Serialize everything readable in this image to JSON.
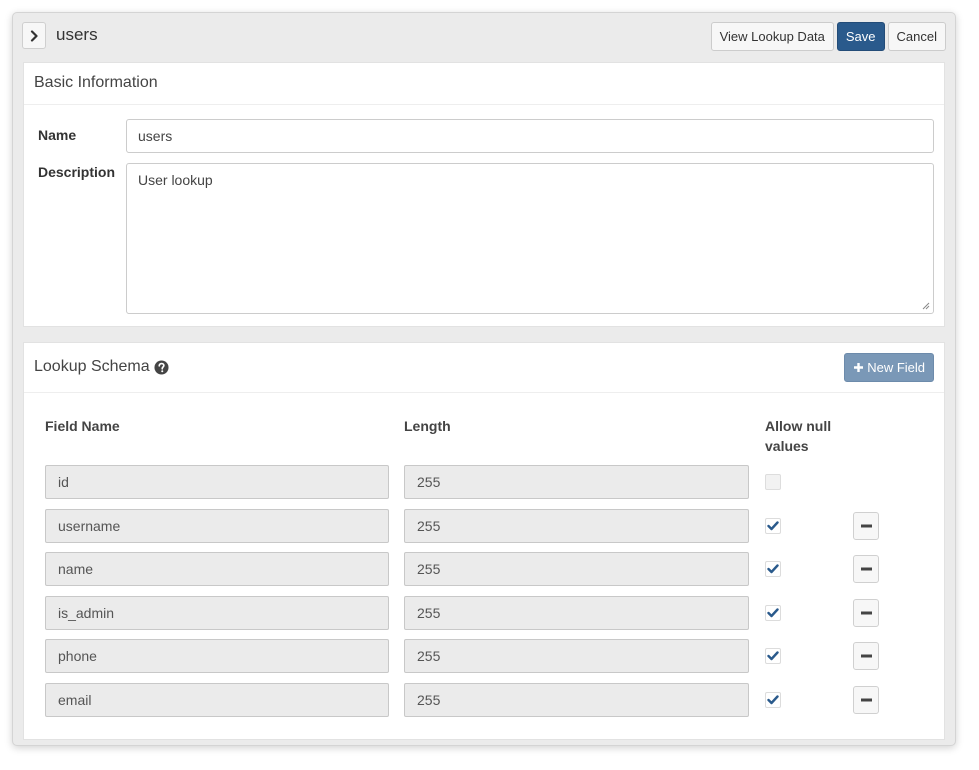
{
  "header": {
    "title": "users",
    "expand_icon": "chevron-right-icon",
    "view_lookup_label": "View Lookup Data",
    "save_label": "Save",
    "cancel_label": "Cancel"
  },
  "basic_info": {
    "heading": "Basic Information",
    "name_label": "Name",
    "name_value": "users",
    "description_label": "Description",
    "description_value": "User lookup"
  },
  "schema": {
    "heading": "Lookup Schema",
    "help_icon": "question-circle-icon",
    "new_field_label": "New Field",
    "columns": {
      "field_name": "Field Name",
      "length": "Length",
      "allow_null": "Allow null values"
    },
    "rows": [
      {
        "field_name": "id",
        "length": "255",
        "allow_null": false,
        "removable": false
      },
      {
        "field_name": "username",
        "length": "255",
        "allow_null": true,
        "removable": true
      },
      {
        "field_name": "name",
        "length": "255",
        "allow_null": true,
        "removable": true
      },
      {
        "field_name": "is_admin",
        "length": "255",
        "allow_null": true,
        "removable": true
      },
      {
        "field_name": "phone",
        "length": "255",
        "allow_null": true,
        "removable": true
      },
      {
        "field_name": "email",
        "length": "255",
        "allow_null": true,
        "removable": true
      }
    ]
  },
  "colors": {
    "primary": "#2a5a8c",
    "secondary_action": "#7a98b7",
    "check": "#2a5a8c"
  }
}
